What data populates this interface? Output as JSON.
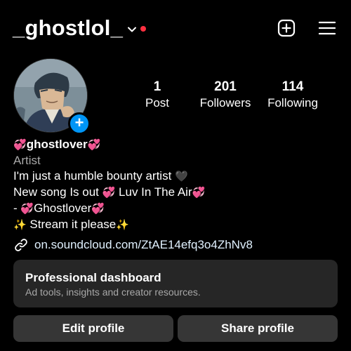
{
  "header": {
    "username": "_ghostlol_",
    "chevron_icon": "chevron-down-icon",
    "notification_dot_color": "#ff3040",
    "create_icon": "plus-square-icon",
    "menu_icon": "hamburger-menu-icon"
  },
  "profile": {
    "avatar_alt": "profile picture",
    "add_story_color": "#0095f6",
    "stats": [
      {
        "value": "1",
        "label": "Post"
      },
      {
        "value": "201",
        "label": "Followers"
      },
      {
        "value": "114",
        "label": "Following"
      }
    ]
  },
  "bio": {
    "name_prefix": "💞",
    "name": "ghostlover",
    "name_suffix": "💞",
    "category": "Artist",
    "line1_text": "I'm just a humble bounty artist ",
    "line1_emoji": "🖤",
    "line2_text": "New song Is out ",
    "line2_emoji1": "💞",
    "line2_text2": " Luv In The Air",
    "line2_emoji2": "💞",
    "line3_text": "- ",
    "line3_emoji1": "💞",
    "line3_text2": "Ghostlover",
    "line3_emoji2": "💞",
    "line4_emoji1": "✨",
    "line4_text": " Stream it please",
    "line4_emoji2": "✨"
  },
  "link": {
    "icon": "link-icon",
    "url": "on.soundcloud.com/ZtAE14efq3o4ZhNv8"
  },
  "dashboard": {
    "title": "Professional dashboard",
    "subtitle": "Ad tools, insights and creator resources."
  },
  "actions": {
    "edit_label": "Edit profile",
    "share_label": "Share profile"
  },
  "colors": {
    "background": "#000000",
    "card": "#262626",
    "button": "#363636",
    "secondary_text": "#a8a8a8",
    "link_text": "#e0f1ff"
  }
}
